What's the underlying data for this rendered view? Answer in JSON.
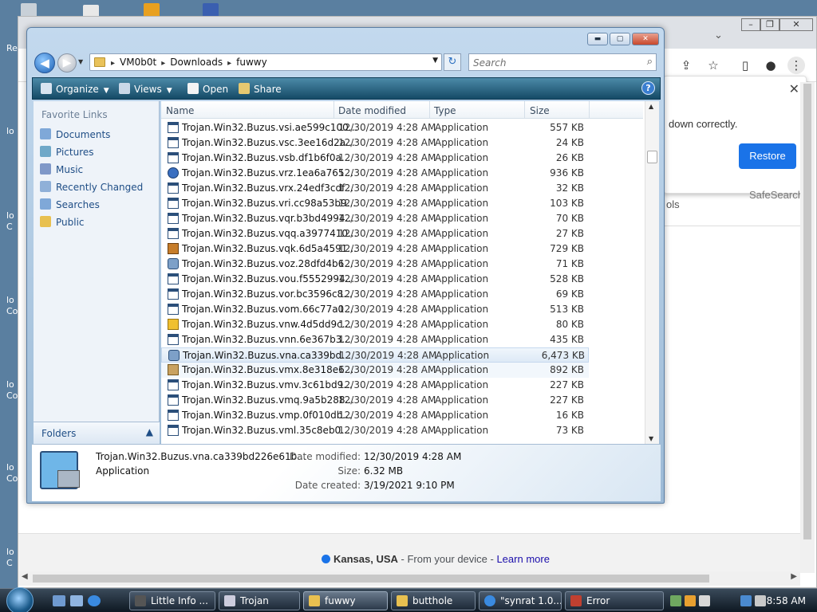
{
  "desktop": {
    "partial_labels": [
      "Re",
      "lo",
      "lo C",
      "lo Co",
      "lo Co",
      "lo Co",
      "lo C"
    ]
  },
  "chrome": {
    "popup": {
      "text": "down correctly.",
      "restore_label": "Restore"
    },
    "safesearch_label": "SafeSearch",
    "tools_partial": "ols",
    "footer": {
      "location": "Kansas, USA",
      "from_device": " - From your device - ",
      "learn_more": "Learn more"
    }
  },
  "explorer": {
    "address": {
      "crumbs": [
        "VM0b0t",
        "Downloads",
        "fuwwy"
      ]
    },
    "search_placeholder": "Search",
    "toolbar": {
      "organize": "Organize",
      "views": "Views",
      "open": "Open",
      "share": "Share"
    },
    "nav": {
      "header": "Favorite Links",
      "items": [
        "Documents",
        "Pictures",
        "Music",
        "Recently Changed",
        "Searches",
        "Public"
      ],
      "folders_label": "Folders"
    },
    "columns": [
      "Name",
      "Date modified",
      "Type",
      "Size"
    ],
    "files": [
      {
        "name": "Trojan.Win32.Buzus.vsi.ae599c100...",
        "date": "12/30/2019 4:28 AM",
        "type": "Application",
        "size": "557 KB",
        "icon": "app-window-icon"
      },
      {
        "name": "Trojan.Win32.Buzus.vsc.3ee16d2a...",
        "date": "12/30/2019 4:28 AM",
        "type": "Application",
        "size": "24 KB",
        "icon": "app-generic-icon"
      },
      {
        "name": "Trojan.Win32.Buzus.vsb.df1b6f0a...",
        "date": "12/30/2019 4:28 AM",
        "type": "Application",
        "size": "26 KB",
        "icon": "app-window-icon"
      },
      {
        "name": "Trojan.Win32.Buzus.vrz.1ea6a765...",
        "date": "12/30/2019 4:28 AM",
        "type": "Application",
        "size": "936 KB",
        "icon": "globe-icon"
      },
      {
        "name": "Trojan.Win32.Buzus.vrx.24edf3cdf...",
        "date": "12/30/2019 4:28 AM",
        "type": "Application",
        "size": "32 KB",
        "icon": "app-generic-icon"
      },
      {
        "name": "Trojan.Win32.Buzus.vri.cc98a53b9...",
        "date": "12/30/2019 4:28 AM",
        "type": "Application",
        "size": "103 KB",
        "icon": "app-window-icon"
      },
      {
        "name": "Trojan.Win32.Buzus.vqr.b3bd4994...",
        "date": "12/30/2019 4:28 AM",
        "type": "Application",
        "size": "70 KB",
        "icon": "app-window-icon"
      },
      {
        "name": "Trojan.Win32.Buzus.vqq.a3977410...",
        "date": "12/30/2019 4:28 AM",
        "type": "Application",
        "size": "27 KB",
        "icon": "app-window-icon"
      },
      {
        "name": "Trojan.Win32.Buzus.vqk.6d5a4591...",
        "date": "12/30/2019 4:28 AM",
        "type": "Application",
        "size": "729 KB",
        "icon": "image-app-icon"
      },
      {
        "name": "Trojan.Win32.Buzus.voz.28dfd4b6...",
        "date": "12/30/2019 4:28 AM",
        "type": "Application",
        "size": "71 KB",
        "icon": "gear-app-icon"
      },
      {
        "name": "Trojan.Win32.Buzus.vou.f5552994...",
        "date": "12/30/2019 4:28 AM",
        "type": "Application",
        "size": "528 KB",
        "icon": "app-window-icon"
      },
      {
        "name": "Trojan.Win32.Buzus.vor.bc3596c8...",
        "date": "12/30/2019 4:28 AM",
        "type": "Application",
        "size": "69 KB",
        "icon": "app-window-icon"
      },
      {
        "name": "Trojan.Win32.Buzus.vom.66c77a0...",
        "date": "12/30/2019 4:28 AM",
        "type": "Application",
        "size": "513 KB",
        "icon": "app-window-icon"
      },
      {
        "name": "Trojan.Win32.Buzus.vnw.4d5dd9c...",
        "date": "12/30/2019 4:28 AM",
        "type": "Application",
        "size": "80 KB",
        "icon": "key-app-icon"
      },
      {
        "name": "Trojan.Win32.Buzus.vnn.6e367b3...",
        "date": "12/30/2019 4:28 AM",
        "type": "Application",
        "size": "435 KB",
        "icon": "app-window-icon"
      },
      {
        "name": "Trojan.Win32.Buzus.vna.ca339bd...",
        "date": "12/30/2019 4:28 AM",
        "type": "Application",
        "size": "6,473 KB",
        "icon": "installer-icon",
        "selected": true
      },
      {
        "name": "Trojan.Win32.Buzus.vmx.8e318e6...",
        "date": "12/30/2019 4:28 AM",
        "type": "Application",
        "size": "892 KB",
        "icon": "package-icon",
        "hovered": true
      },
      {
        "name": "Trojan.Win32.Buzus.vmv.3c61bd9...",
        "date": "12/30/2019 4:28 AM",
        "type": "Application",
        "size": "227 KB",
        "icon": "app-window-icon"
      },
      {
        "name": "Trojan.Win32.Buzus.vmq.9a5b288...",
        "date": "12/30/2019 4:28 AM",
        "type": "Application",
        "size": "227 KB",
        "icon": "app-window-icon"
      },
      {
        "name": "Trojan.Win32.Buzus.vmp.0f010db...",
        "date": "12/30/2019 4:28 AM",
        "type": "Application",
        "size": "16 KB",
        "icon": "app-window-icon"
      },
      {
        "name": "Trojan.Win32.Buzus.vml.35c8eb0...",
        "date": "12/30/2019 4:28 AM",
        "type": "Application",
        "size": "73 KB",
        "icon": "app-window-icon"
      }
    ],
    "details": {
      "name": "Trojan.Win32.Buzus.vna.ca339bd226e61b...",
      "type": "Application",
      "date_modified_label": "Date modified:",
      "date_modified": "12/30/2019 4:28 AM",
      "size_label": "Size:",
      "size": "6.32 MB",
      "date_created_label": "Date created:",
      "date_created": "3/19/2021 9:10 PM"
    }
  },
  "taskbar": {
    "buttons": [
      "Little Info ...",
      "Trojan",
      "fuwwy",
      "butthole",
      "\"synrat 1.0...",
      "Error"
    ],
    "active_index": 2,
    "clock": "8:58 AM"
  }
}
